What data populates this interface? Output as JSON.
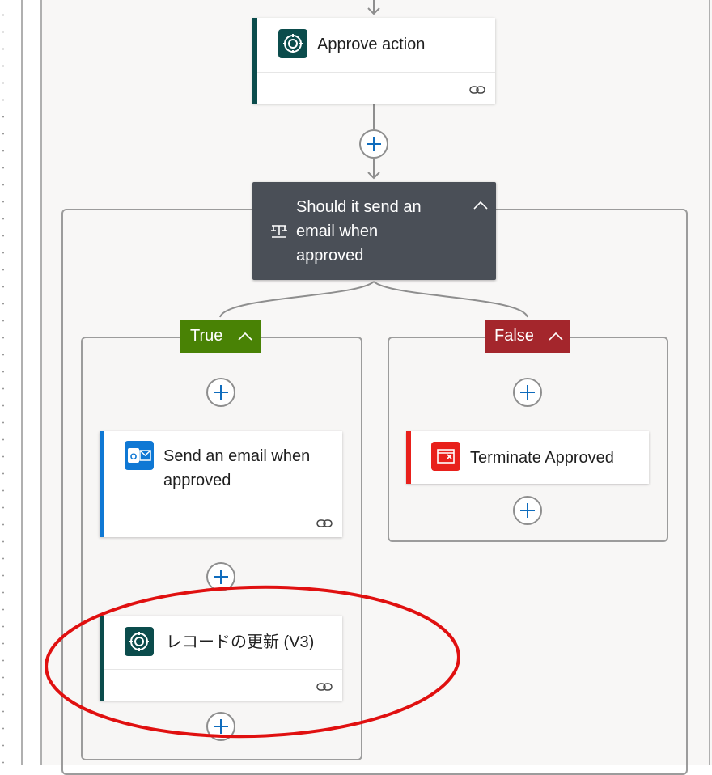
{
  "flow": {
    "approve_action": {
      "title": "Approve action",
      "icon": "dataverse-icon"
    },
    "condition": {
      "title": "Should it send an email when approved",
      "icon": "condition-icon"
    },
    "true_branch": {
      "label": "True",
      "color": "#498205",
      "actions": [
        {
          "title": "Send an email when approved",
          "icon": "outlook-icon",
          "accent": "#0f78d4"
        },
        {
          "title": "レコードの更新 (V3)",
          "icon": "dataverse-icon",
          "accent": "#0b4c4c"
        }
      ]
    },
    "false_branch": {
      "label": "False",
      "color": "#a4262c",
      "actions": [
        {
          "title": "Terminate Approved",
          "icon": "terminate-icon",
          "accent": "#e8201b"
        }
      ]
    }
  },
  "colors": {
    "dataverse": "#0b4c4c",
    "outlook": "#0f78d4",
    "terminate": "#e8201b",
    "condition_header": "#4a4f57",
    "highlight_ellipse": "#e01010"
  }
}
